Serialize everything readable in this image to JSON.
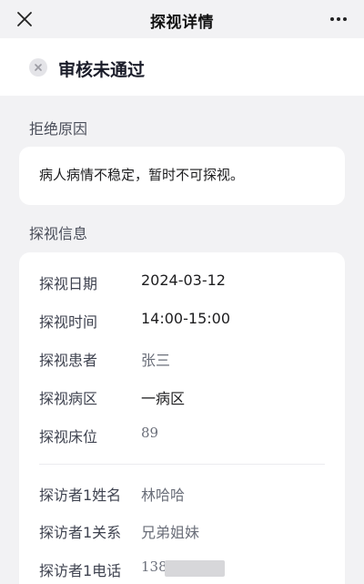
{
  "navbar": {
    "title": "探视详情",
    "close_icon": "close-icon",
    "more_icon": "more-dots-icon"
  },
  "status": {
    "icon": "x-circle-icon",
    "text": "审核未通过"
  },
  "reject": {
    "section_title": "拒绝原因",
    "reason": "病人病情不稳定，暂时不可探视。"
  },
  "visit_info": {
    "section_title": "探视信息",
    "rows": [
      {
        "label": "探视日期",
        "value": "2024-03-12"
      },
      {
        "label": "探视时间",
        "value": "14:00-15:00"
      },
      {
        "label": "探视患者",
        "value": "张三"
      },
      {
        "label": "探视病区",
        "value": "一病区"
      },
      {
        "label": "探视床位",
        "value": "89"
      }
    ],
    "visitor_rows": [
      {
        "label": "探访者1姓名",
        "value": "林哈哈"
      },
      {
        "label": "探访者1关系",
        "value": "兄弟姐妹"
      },
      {
        "label": "探访者1电话",
        "value": "138"
      }
    ]
  },
  "colors": {
    "background": "#f2f2f4",
    "card": "#ffffff",
    "status_icon_bg": "#e4e4e8"
  }
}
